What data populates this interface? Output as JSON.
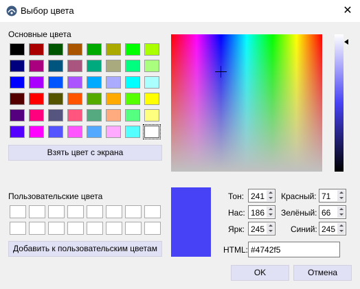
{
  "window": {
    "title": "Выбор цвета",
    "close_glyph": "✕"
  },
  "basic": {
    "label": "Основные цвета",
    "colors": [
      [
        "#000000",
        "#aa0000",
        "#005500",
        "#aa5500",
        "#00aa00",
        "#aaaa00",
        "#00ff00",
        "#aaff00"
      ],
      [
        "#00007f",
        "#aa007f",
        "#00557f",
        "#aa557f",
        "#00aa7f",
        "#aaaa7f",
        "#00ff7f",
        "#aaff7f"
      ],
      [
        "#0000ff",
        "#aa00ff",
        "#0055ff",
        "#aa55ff",
        "#00aaff",
        "#aaaaff",
        "#00ffff",
        "#aaffff"
      ],
      [
        "#550000",
        "#ff0000",
        "#555500",
        "#ff5500",
        "#55aa00",
        "#ffaa00",
        "#55ff00",
        "#ffff00"
      ],
      [
        "#55007f",
        "#ff007f",
        "#55557f",
        "#ff557f",
        "#55aa7f",
        "#ffaa7f",
        "#55ff7f",
        "#ffff7f"
      ],
      [
        "#5500ff",
        "#ff00ff",
        "#5555ff",
        "#ff55ff",
        "#55aaff",
        "#ffaaff",
        "#55ffff",
        "#ffffff"
      ]
    ],
    "pick_screen_label": "Взять цвет с экрана"
  },
  "custom": {
    "label": "Пользовательские цвета",
    "add_label": "Добавить к пользовательским цветам"
  },
  "current": {
    "hue_label": "Тон:",
    "hue": "241",
    "sat_label": "Нас:",
    "sat": "186",
    "val_label": "Ярк:",
    "val": "245",
    "red_label": "Красный:",
    "red": "71",
    "green_label": "Зелёный:",
    "green": "66",
    "blue_label": "Синий:",
    "blue": "245",
    "html_label": "HTML:",
    "html": "#4742f5",
    "preview_color": "#4742f5"
  },
  "buttons": {
    "ok": "OK",
    "cancel": "Отмена"
  }
}
